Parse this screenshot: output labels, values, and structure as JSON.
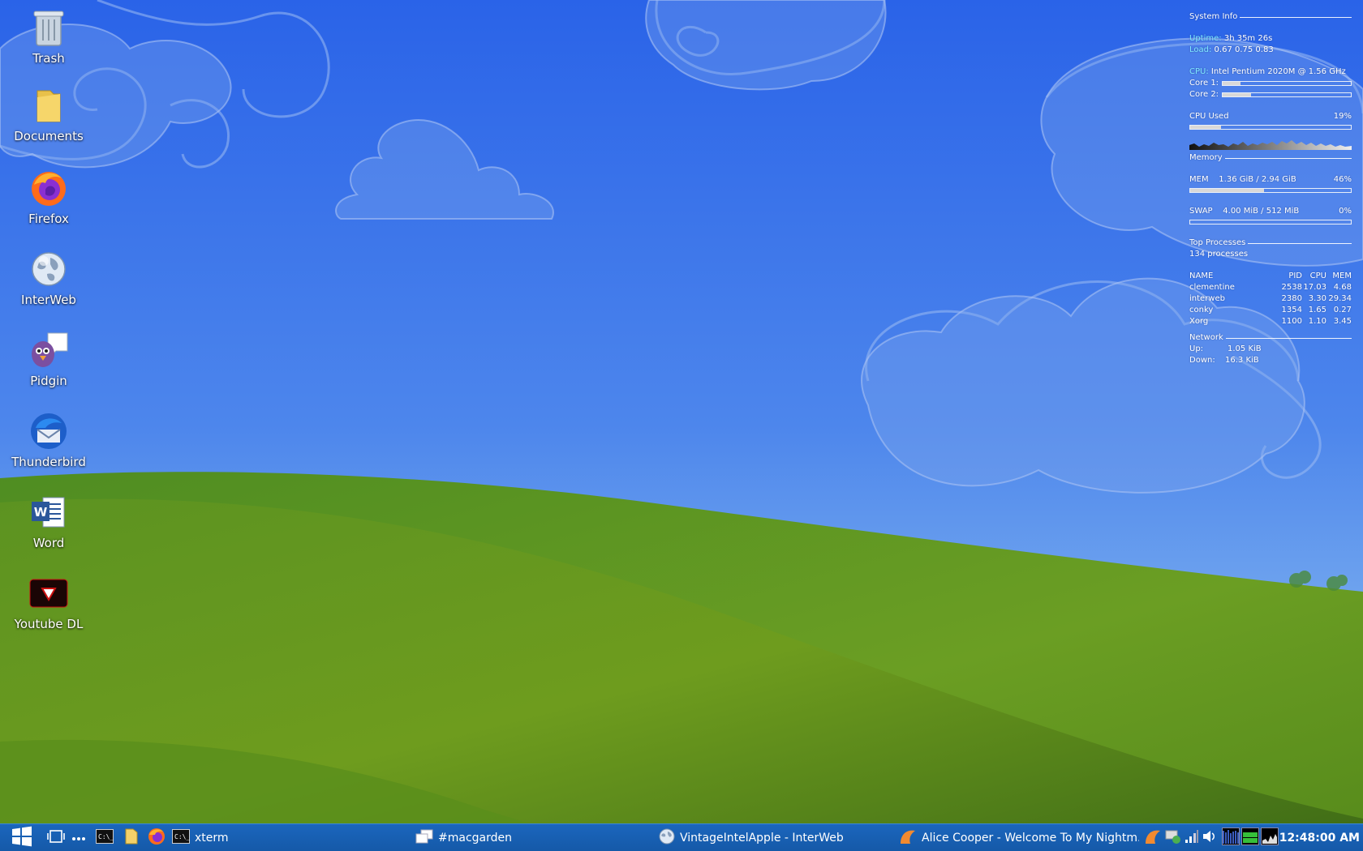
{
  "desktop": {
    "icons": [
      {
        "label": "Trash",
        "icon": "trash-icon"
      },
      {
        "label": "Documents",
        "icon": "folder-icon"
      },
      {
        "label": "Firefox",
        "icon": "firefox-icon"
      },
      {
        "label": "InterWeb",
        "icon": "globe-icon"
      },
      {
        "label": "Pidgin",
        "icon": "pidgin-icon"
      },
      {
        "label": "Thunderbird",
        "icon": "thunderbird-icon"
      },
      {
        "label": "Word",
        "icon": "word-icon"
      },
      {
        "label": "Youtube DL",
        "icon": "youtube-dl-icon"
      }
    ]
  },
  "conky": {
    "system_info_title": "System Info",
    "uptime_key": "Uptime:",
    "uptime_value": "3h 35m 26s",
    "load_key": "Load:",
    "load_value": "0.67 0.75 0.83",
    "cpu_key": "CPU:",
    "cpu_value": "Intel Pentium 2020M @ 1.56 GHz",
    "core1_label": "Core 1:",
    "core1_level": 0.14,
    "core2_label": "Core 2:",
    "core2_level": 0.22,
    "cpu_used_label": "CPU Used",
    "cpu_used_value": "19%",
    "cpu_used_level": 0.19,
    "memory_title": "Memory",
    "mem_label": "MEM",
    "mem_value": "1.36 GiB / 2.94 GiB",
    "mem_percent": "46%",
    "mem_level": 0.46,
    "swap_label": "SWAP",
    "swap_value": "4.00 MiB / 512 MiB",
    "swap_percent": "0%",
    "swap_level": 0.0,
    "top_processes_title": "Top Processes",
    "process_count": "134 processes",
    "proc_headers": {
      "name": "NAME",
      "pid": "PID",
      "cpu": "CPU",
      "mem": "MEM"
    },
    "processes": [
      {
        "name": "clementine",
        "pid": "2538",
        "cpu": "17.03",
        "mem": "4.68"
      },
      {
        "name": "interweb",
        "pid": "2380",
        "cpu": "3.30",
        "mem": "29.34"
      },
      {
        "name": "conky",
        "pid": "1354",
        "cpu": "1.65",
        "mem": "0.27"
      },
      {
        "name": "Xorg",
        "pid": "1100",
        "cpu": "1.10",
        "mem": "3.45"
      }
    ],
    "network_title": "Network",
    "up_label": "Up:",
    "up_value": "1.05 KiB",
    "down_label": "Down:",
    "down_value": "16.3 KiB"
  },
  "taskbar": {
    "tasks": [
      {
        "label": "xterm",
        "icon": "terminal-icon"
      },
      {
        "label": "#macgarden",
        "icon": "chat-window-icon"
      },
      {
        "label": "VintageIntelApple - InterWeb",
        "icon": "globe-icon"
      },
      {
        "label": "Alice Cooper - Welcome To My Nightm...",
        "icon": "clementine-icon"
      }
    ],
    "clock": "12:48:00 AM"
  }
}
